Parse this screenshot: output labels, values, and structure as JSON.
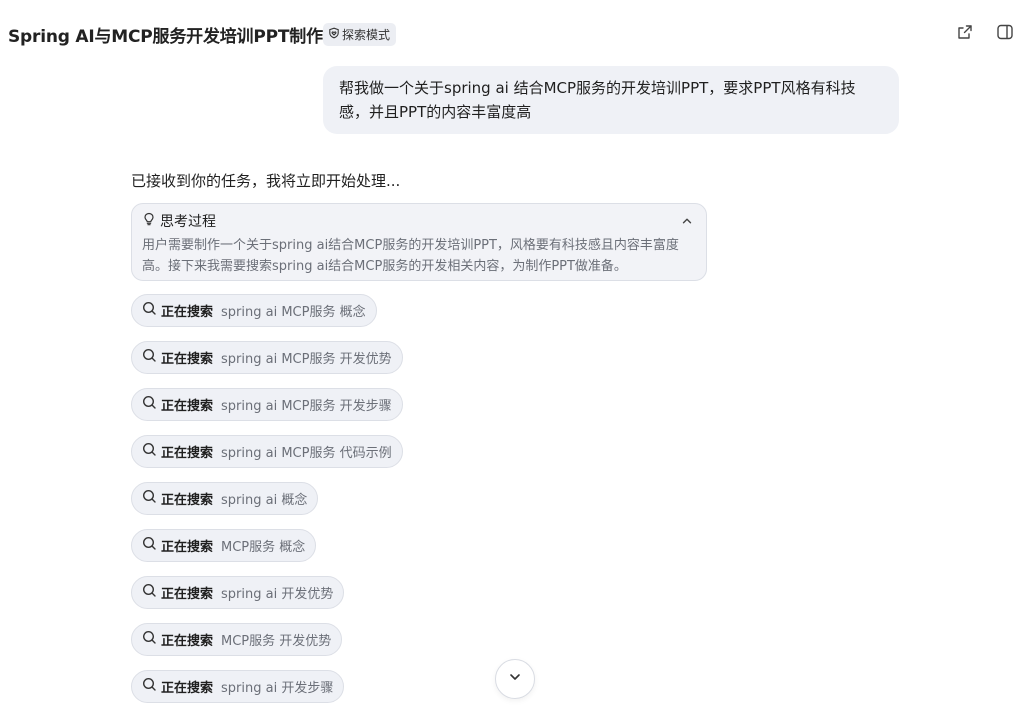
{
  "header": {
    "title": "Spring AI与MCP服务开发培训PPT制作",
    "mode_badge": "探索模式",
    "share_icon": "share-icon",
    "panel_icon": "sidebar-panel-icon"
  },
  "user_message": {
    "text": "帮我做一个关于spring ai 结合MCP服务的开发培训PPT，要求PPT风格有科技感，并且PPT的内容丰富度高"
  },
  "assistant": {
    "ack": "已接收到你的任务，我将立即开始处理...",
    "thinking": {
      "title": "思考过程",
      "body": "用户需要制作一个关于spring ai结合MCP服务的开发培训PPT，风格要有科技感且内容丰富度高。接下来我需要搜索spring ai结合MCP服务的开发相关内容，为制作PPT做准备。",
      "icon": "lightbulb-icon",
      "toggle_icon": "chevron-up-icon"
    },
    "searches": [
      {
        "label": "正在搜索",
        "query": "spring ai MCP服务 概念"
      },
      {
        "label": "正在搜索",
        "query": "spring ai MCP服务 开发优势"
      },
      {
        "label": "正在搜索",
        "query": "spring ai MCP服务 开发步骤"
      },
      {
        "label": "正在搜索",
        "query": "spring ai MCP服务 代码示例"
      },
      {
        "label": "正在搜索",
        "query": "spring ai 概念"
      },
      {
        "label": "正在搜索",
        "query": "MCP服务 概念"
      },
      {
        "label": "正在搜索",
        "query": "spring ai 开发优势"
      },
      {
        "label": "正在搜索",
        "query": "MCP服务 开发优势"
      },
      {
        "label": "正在搜索",
        "query": "spring ai 开发步骤"
      }
    ]
  },
  "scroll_down_icon": "chevron-down-icon",
  "colors": {
    "bubble_bg": "#eff1f6",
    "chip_border": "#dcdfe6",
    "muted_text": "#6b6f78"
  }
}
